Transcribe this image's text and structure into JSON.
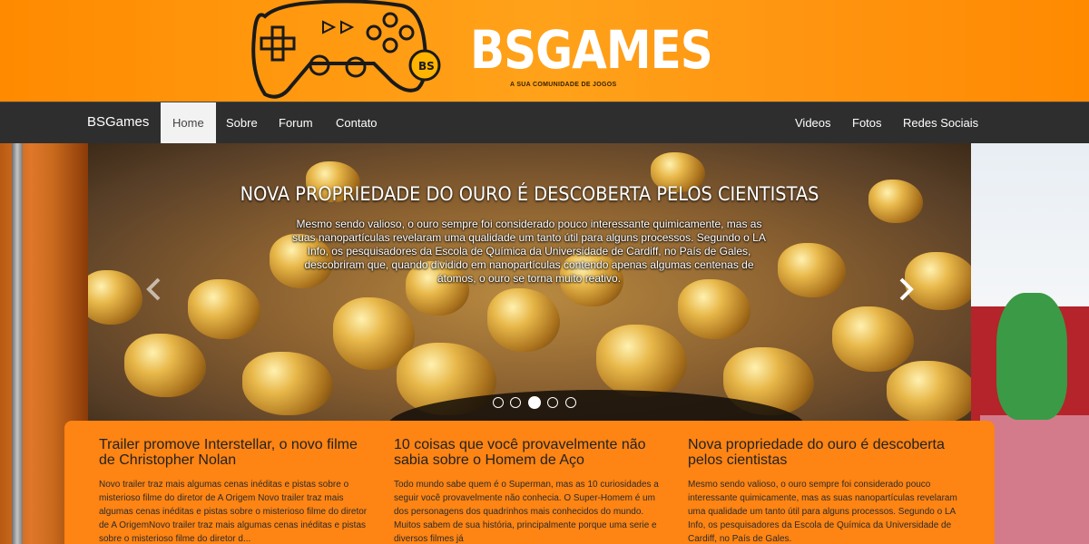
{
  "header": {
    "brand": "BSGAMES",
    "tagline": "A SUA COMUNIDADE DE JOGOS"
  },
  "navbar": {
    "brand": "BSGames",
    "left_items": [
      {
        "label": "Home",
        "active": true
      },
      {
        "label": "Sobre"
      },
      {
        "label": "Forum"
      },
      {
        "label": "Contato"
      }
    ],
    "right_items": [
      {
        "label": "Videos"
      },
      {
        "label": "Fotos"
      },
      {
        "label": "Redes Sociais"
      }
    ]
  },
  "carousel": {
    "title": "NOVA PROPRIEDADE DO OURO É DESCOBERTA PELOS CIENTISTAS",
    "text": "Mesmo sendo valioso, o ouro sempre foi considerado pouco interessante quimicamente, mas as suas nanopartículas revelaram uma qualidade um tanto útil para alguns processos. Segundo o LA Info, os pesquisadores da Escola de Química da Universidade de Cardiff, no País de Gales, descobriram que, quando dividido em nanopartículas contendo apenas algumas centenas de átomos, o ouro se torna muito reativo.",
    "prev_icon": "chevron-left-icon",
    "next_icon": "chevron-right-icon",
    "slide_count": 5,
    "active_slide": 3
  },
  "articles": [
    {
      "title": "Trailer promove Interstellar, o novo filme de Christopher Nolan",
      "excerpt": "Novo trailer traz mais algumas cenas inéditas e pistas sobre o misterioso filme do diretor de A Origem Novo trailer traz mais algumas cenas inéditas e pistas sobre o misterioso filme do diretor de A OrigemNovo trailer traz mais algumas cenas inéditas e pistas sobre o misterioso filme do diretor d..."
    },
    {
      "title": "10 coisas que você provavelmente não sabia sobre o Homem de Aço",
      "excerpt": "Todo mundo sabe quem é o Superman, mas as 10 curiosidades a seguir você provavelmente não conhecia. O Super-Homem é um dos personagens dos quadrinhos mais conhecidos do mundo. Muitos sabem de sua história, principalmente porque uma serie e diversos filmes já"
    },
    {
      "title": "Nova propriedade do ouro é descoberta pelos cientistas",
      "excerpt": "Mesmo sendo valioso, o ouro sempre foi considerado pouco interessante quimicamente, mas as suas nanopartículas revelaram uma qualidade um tanto útil para alguns processos. Segundo o LA Info, os pesquisadores da Escola de Química da Universidade de Cardiff, no País de Gales."
    }
  ],
  "colors": {
    "banner_orange": "#ff8a00",
    "navbar_dark": "#2e2e2e",
    "content_orange": "#fe8413"
  }
}
